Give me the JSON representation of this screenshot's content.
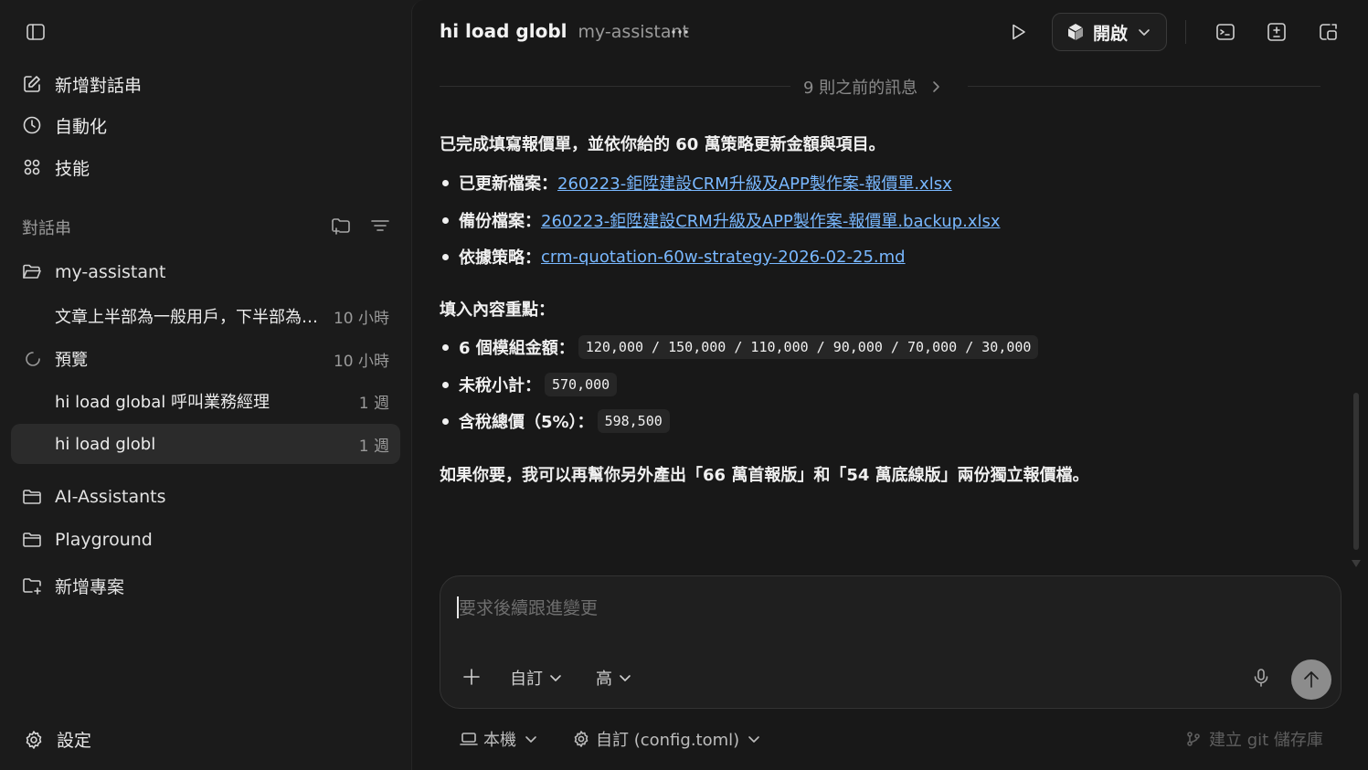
{
  "sidebar": {
    "nav": [
      {
        "label": "新增對話串",
        "icon": "compose-icon"
      },
      {
        "label": "自動化",
        "icon": "clock-icon"
      },
      {
        "label": "技能",
        "icon": "skills-grid-icon"
      }
    ],
    "section_title": "對話串",
    "folders": {
      "my_assistant": "my-assistant",
      "ai_assistants": "AI-Assistants",
      "playground": "Playground",
      "new_project": "新增專案"
    },
    "threads": [
      {
        "name": "文章上半部為一般用戶，下半部為技術人員說明",
        "time": "10 小時"
      },
      {
        "name": "預覽",
        "time": "10 小時"
      },
      {
        "name": "hi load global 呼叫業務經理",
        "time": "1 週"
      },
      {
        "name": "hi load globl",
        "time": "1 週"
      }
    ],
    "settings_label": "設定"
  },
  "header": {
    "title": "hi load globl",
    "subtitle": "my-assistant",
    "open_label": "開啟"
  },
  "conversation": {
    "previous_messages": "9 則之前的訊息",
    "intro": "已完成填寫報價單，並依你給的 60 萬策略更新金額與項目。",
    "files": [
      {
        "label": "已更新檔案：",
        "link": "260223-鉅陞建設CRM升級及APP製作案-報價單.xlsx"
      },
      {
        "label": "備份檔案：",
        "link": "260223-鉅陞建設CRM升級及APP製作案-報價單.backup.xlsx"
      },
      {
        "label": "依據策略：",
        "link": "crm-quotation-60w-strategy-2026-02-25.md"
      }
    ],
    "highlights_title": "填入內容重點：",
    "highlights": [
      {
        "label": "6 個模組金額：",
        "code": "120,000 / 150,000 / 110,000 / 90,000 / 70,000 / 30,000"
      },
      {
        "label": "未稅小計：",
        "code": "570,000"
      },
      {
        "label": "含稅總價（5%）：",
        "code": "598,500"
      }
    ],
    "closing": "如果你要，我可以再幫你另外產出「66 萬首報版」和「54 萬底線版」兩份獨立報價檔。"
  },
  "composer": {
    "placeholder": "要求後續跟進變更",
    "mode_label": "自訂",
    "effort_label": "高"
  },
  "footer": {
    "env_label": "本機",
    "config_label": "自訂 (config.toml)",
    "git_label": "建立 git 儲存庫"
  },
  "colors": {
    "background": "#1b1b1b",
    "link": "#79b8ff",
    "send_button": "#8c8c8c"
  }
}
